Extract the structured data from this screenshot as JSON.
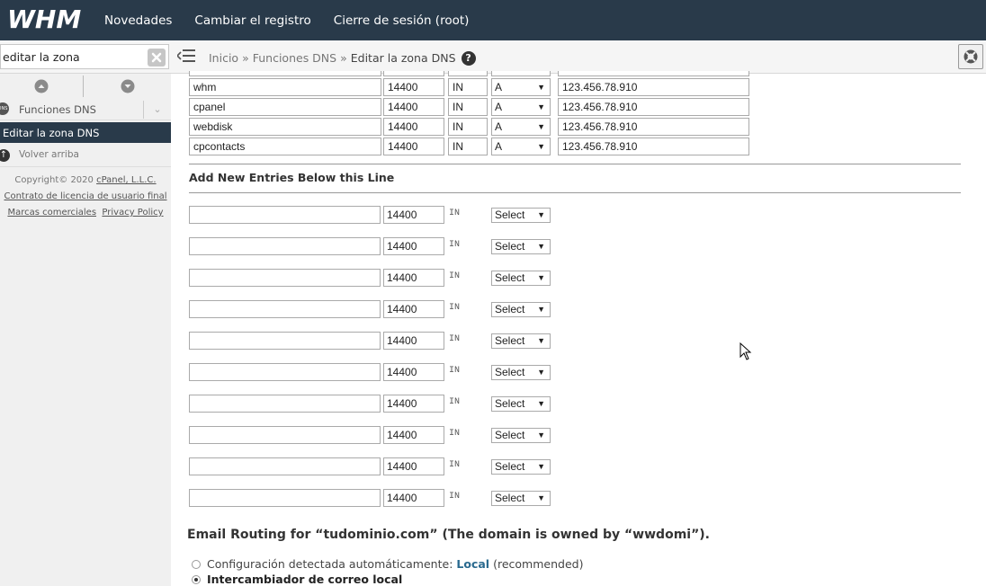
{
  "topbar": {
    "logo": "WHM",
    "nav": [
      "Novedades",
      "Cambiar el registro",
      "Cierre de sesión (root)"
    ]
  },
  "subbar": {
    "search_value": "editar la zona",
    "breadcrumb": [
      "Inicio",
      "Funciones DNS",
      "Editar la zona DNS"
    ],
    "breadcrumb_sep": "»",
    "help": "?"
  },
  "sidebar": {
    "category": "Funciones DNS",
    "category_icon": "DNS",
    "active_item": "Editar la zona DNS",
    "back_to_top": "Volver arriba",
    "copyright_prefix": "Copyright© 2020 ",
    "copyright_link": "cPanel, L.L.C.",
    "license_link": "Contrato de licencia de usuario final",
    "trademarks_link": "Marcas comerciales",
    "privacy_link": "Privacy Policy"
  },
  "records": [
    {
      "name": "whm",
      "ttl": "14400",
      "class": "IN",
      "type": "A",
      "address": "123.456.78.910"
    },
    {
      "name": "cpanel",
      "ttl": "14400",
      "class": "IN",
      "type": "A",
      "address": "123.456.78.910"
    },
    {
      "name": "webdisk",
      "ttl": "14400",
      "class": "IN",
      "type": "A",
      "address": "123.456.78.910"
    },
    {
      "name": "cpcontacts",
      "ttl": "14400",
      "class": "IN",
      "type": "A",
      "address": "123.456.78.910"
    }
  ],
  "new_entries": {
    "title": "Add New Entries Below this Line",
    "rows": [
      {
        "ttl": "14400",
        "class": "IN",
        "type": "Select"
      },
      {
        "ttl": "14400",
        "class": "IN",
        "type": "Select"
      },
      {
        "ttl": "14400",
        "class": "IN",
        "type": "Select"
      },
      {
        "ttl": "14400",
        "class": "IN",
        "type": "Select"
      },
      {
        "ttl": "14400",
        "class": "IN",
        "type": "Select"
      },
      {
        "ttl": "14400",
        "class": "IN",
        "type": "Select"
      },
      {
        "ttl": "14400",
        "class": "IN",
        "type": "Select"
      },
      {
        "ttl": "14400",
        "class": "IN",
        "type": "Select"
      },
      {
        "ttl": "14400",
        "class": "IN",
        "type": "Select"
      },
      {
        "ttl": "14400",
        "class": "IN",
        "type": "Select"
      }
    ]
  },
  "email_routing": {
    "title": "Email Routing for “tudominio.com” (The domain is owned by “wwdomi”).",
    "option_auto_prefix": "Configuración detectada automáticamente:",
    "option_auto_value": "Local",
    "option_auto_suffix": "(recommended)",
    "option_local": "Intercambiador de correo local",
    "selected": "local"
  }
}
